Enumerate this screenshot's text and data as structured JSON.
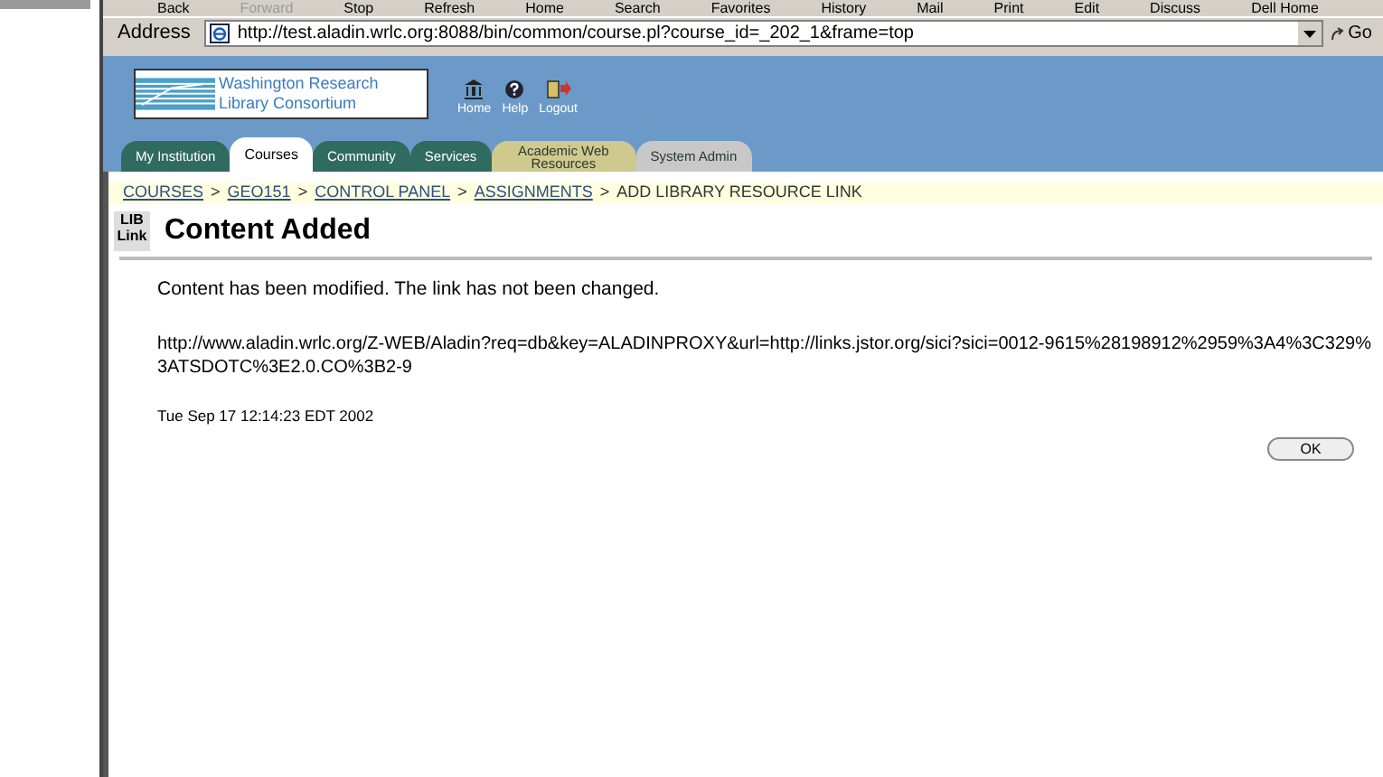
{
  "browser": {
    "toolbar": [
      {
        "label": "Back",
        "disabled": false
      },
      {
        "label": "Forward",
        "disabled": true
      },
      {
        "label": "Stop",
        "disabled": false
      },
      {
        "label": "Refresh",
        "disabled": false
      },
      {
        "label": "Home",
        "disabled": false
      },
      {
        "label": "Search",
        "disabled": false
      },
      {
        "label": "Favorites",
        "disabled": false
      },
      {
        "label": "History",
        "disabled": false
      },
      {
        "label": "Mail",
        "disabled": false
      },
      {
        "label": "Print",
        "disabled": false
      },
      {
        "label": "Edit",
        "disabled": false
      },
      {
        "label": "Discuss",
        "disabled": false
      },
      {
        "label": "Dell Home",
        "disabled": false
      }
    ],
    "address_label": "Address",
    "url": "http://test.aladin.wrlc.org:8088/bin/common/course.pl?course_id=_202_1&frame=top",
    "go": "Go"
  },
  "header": {
    "logo_text": "Washington Research Library Consortium",
    "icons": [
      "Home",
      "Help",
      "Logout"
    ],
    "tabs": [
      {
        "label": "My Institution",
        "selected": false,
        "kind": "green"
      },
      {
        "label": "Courses",
        "selected": true,
        "kind": "green"
      },
      {
        "label": "Community",
        "selected": false,
        "kind": "green"
      },
      {
        "label": "Services",
        "selected": false,
        "kind": "green"
      },
      {
        "label": "Academic Web Resources",
        "selected": false,
        "kind": "tan"
      },
      {
        "label": "System Admin",
        "selected": false,
        "kind": "grey"
      }
    ]
  },
  "breadcrumb": [
    {
      "label": "COURSES",
      "kind": "link"
    },
    {
      "label": ">",
      "kind": "separator"
    },
    {
      "label": "GEO151",
      "kind": "link"
    },
    {
      "label": ">",
      "kind": "separator"
    },
    {
      "label": "CONTROL PANEL",
      "kind": "link"
    },
    {
      "label": ">",
      "kind": "separator"
    },
    {
      "label": "ASSIGNMENTS",
      "kind": "link"
    },
    {
      "label": ">",
      "kind": "separator"
    },
    {
      "label": "ADD LIBRARY RESOURCE LINK",
      "kind": "current"
    }
  ],
  "page": {
    "icon_text": "LIB Link",
    "title": "Content Added",
    "message": "Content has been modified. The link has not been changed.",
    "url": "http://www.aladin.wrlc.org/Z-WEB/Aladin?req=db&key=ALADINPROXY&url=http://links.jstor.org/sici?sici=0012-9615%28198912%2959%3A4%3C329%3ATSDOTC%3E2.0.CO%3B2-9",
    "timestamp": "Tue Sep 17 12:14:23 EDT 2002",
    "ok": "OK"
  }
}
